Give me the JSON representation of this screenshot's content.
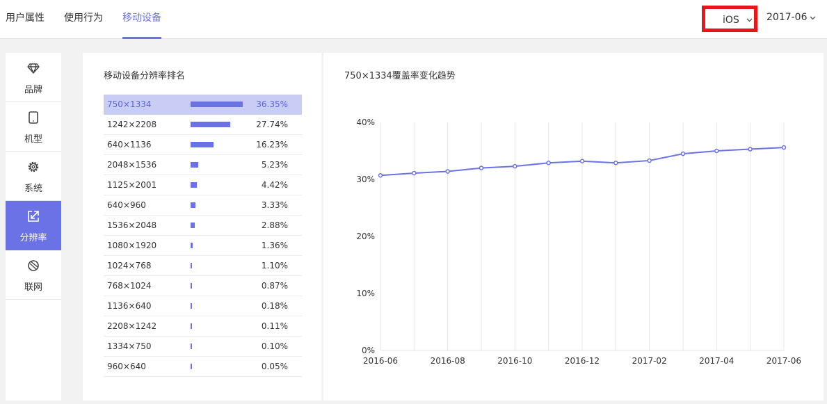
{
  "tabs": [
    {
      "label": "用户属性",
      "active": false
    },
    {
      "label": "使用行为",
      "active": false
    },
    {
      "label": "移动设备",
      "active": true
    }
  ],
  "os_select": {
    "value": "iOS",
    "icon": "chevron-down-icon"
  },
  "month_select": {
    "value": "2017-06",
    "icon": "chevron-down-icon"
  },
  "sidebar": {
    "items": [
      {
        "label": "品牌",
        "icon": "diamond-icon",
        "active": false
      },
      {
        "label": "机型",
        "icon": "tablet-icon",
        "active": false
      },
      {
        "label": "系统",
        "icon": "gear-icon",
        "active": false
      },
      {
        "label": "分辨率",
        "icon": "resize-icon",
        "active": true
      },
      {
        "label": "联网",
        "icon": "network-icon",
        "active": false
      }
    ]
  },
  "ranking": {
    "title": "移动设备分辨率排名",
    "rows": [
      {
        "res": "750×1334",
        "pct": "36.35%",
        "value": 36.35
      },
      {
        "res": "1242×2208",
        "pct": "27.74%",
        "value": 27.74
      },
      {
        "res": "640×1136",
        "pct": "16.23%",
        "value": 16.23
      },
      {
        "res": "2048×1536",
        "pct": "5.23%",
        "value": 5.23
      },
      {
        "res": "1125×2001",
        "pct": "4.42%",
        "value": 4.42
      },
      {
        "res": "640×960",
        "pct": "3.33%",
        "value": 3.33
      },
      {
        "res": "1536×2048",
        "pct": "2.88%",
        "value": 2.88
      },
      {
        "res": "1080×1920",
        "pct": "1.36%",
        "value": 1.36
      },
      {
        "res": "1024×768",
        "pct": "1.10%",
        "value": 1.1
      },
      {
        "res": "768×1024",
        "pct": "0.87%",
        "value": 0.87
      },
      {
        "res": "1136×640",
        "pct": "0.18%",
        "value": 0.18
      },
      {
        "res": "2208×1242",
        "pct": "0.11%",
        "value": 0.11
      },
      {
        "res": "1334×750",
        "pct": "0.10%",
        "value": 0.1
      },
      {
        "res": "960×640",
        "pct": "0.05%",
        "value": 0.05
      }
    ]
  },
  "colors": {
    "accent": "#6b72e6",
    "highlight": "#c9cdf6",
    "red_box": "#e8151b"
  },
  "chart_data": {
    "type": "line",
    "title": "750×1334覆盖率变化趋势",
    "x": [
      "2016-06",
      "2016-07",
      "2016-08",
      "2016-09",
      "2016-10",
      "2016-11",
      "2016-12",
      "2017-01",
      "2017-02",
      "2017-03",
      "2017-04",
      "2017-05",
      "2017-06"
    ],
    "x_tick_labels": [
      "2016-06",
      "2016-08",
      "2016-10",
      "2016-12",
      "2017-02",
      "2017-04",
      "2017-06"
    ],
    "series": [
      {
        "values": [
          30.7,
          31.1,
          31.4,
          32.0,
          32.3,
          32.9,
          33.2,
          32.9,
          33.3,
          34.5,
          35.0,
          35.3,
          35.6
        ]
      }
    ],
    "y_ticks": [
      "0%",
      "10%",
      "20%",
      "30%",
      "40%"
    ],
    "ylim": [
      0,
      40
    ],
    "grid": "vertical"
  }
}
